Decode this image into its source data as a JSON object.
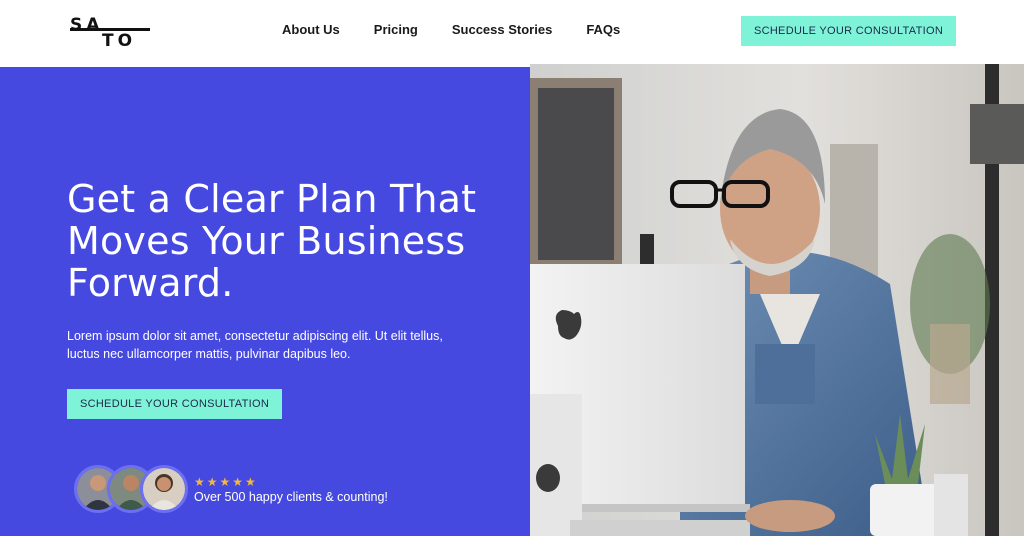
{
  "header": {
    "logo_top": "SA",
    "logo_bottom": "TO",
    "nav": [
      "About Us",
      "Pricing",
      "Success Stories",
      "FAQs"
    ],
    "cta_label": "SCHEDULE YOUR CONSULTATION"
  },
  "hero": {
    "title": "Get a Clear Plan That Moves Your Business Forward.",
    "subtitle": "Lorem ipsum dolor sit amet, consectetur adipiscing elit. Ut elit tellus, luctus nec ullamcorper mattis, pulvinar dapibus leo.",
    "cta_label": "SCHEDULE YOUR CONSULTATION",
    "rating_stars": "★★★★★",
    "rating": 5,
    "social_proof": "Over 500 happy clients & counting!"
  },
  "colors": {
    "accent": "#7ff3d8",
    "hero_bg": "#4549df",
    "star": "#f5b73b"
  },
  "icons": [
    "star-icon",
    "avatar",
    "apple-logo"
  ]
}
